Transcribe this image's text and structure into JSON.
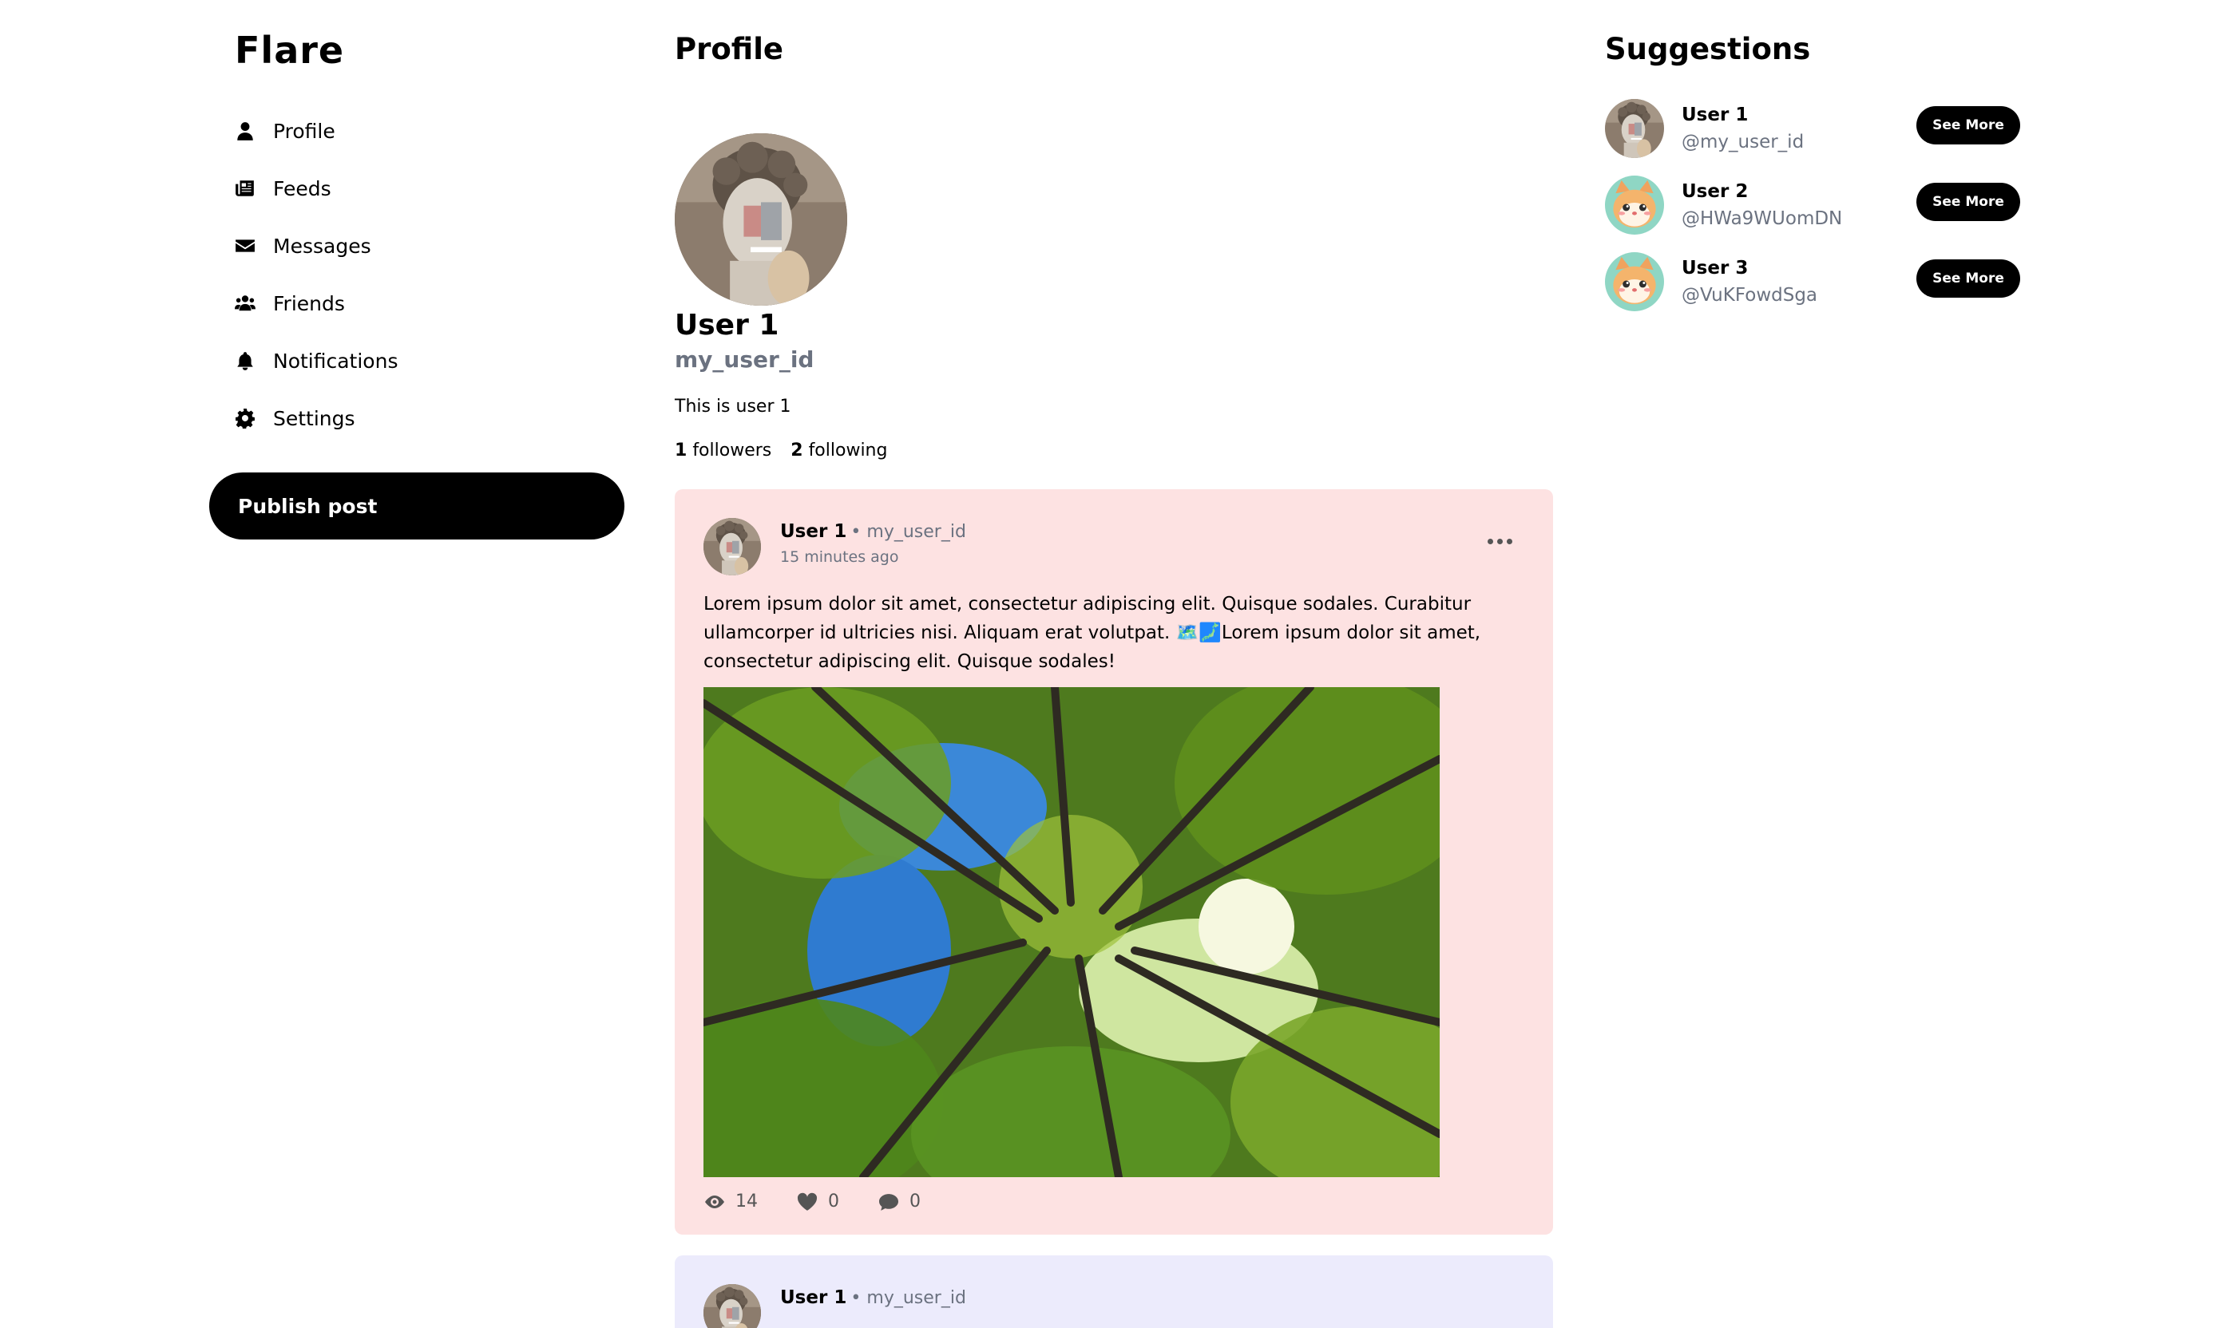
{
  "brand": "Flare",
  "nav": [
    {
      "label": "Profile",
      "icon": "user-icon"
    },
    {
      "label": "Feeds",
      "icon": "newspaper-icon"
    },
    {
      "label": "Messages",
      "icon": "envelope-icon"
    },
    {
      "label": "Friends",
      "icon": "users-icon"
    },
    {
      "label": "Notifications",
      "icon": "bell-icon"
    },
    {
      "label": "Settings",
      "icon": "gear-icon"
    }
  ],
  "publish_label": "Publish post",
  "profile": {
    "page_title": "Profile",
    "name": "User 1",
    "handle": "my_user_id",
    "bio": "This is user 1",
    "followers_count": "1",
    "followers_label": "followers",
    "following_count": "2",
    "following_label": "following"
  },
  "posts": [
    {
      "author": "User 1",
      "handle": "• my_user_id",
      "time": "15 minutes ago",
      "text": "Lorem ipsum dolor sit amet, consectetur adipiscing elit. Quisque sodales. Curabitur ullamcorper id ultricies nisi. Aliquam erat volutpat. 🗺️🗾Lorem ipsum dolor sit amet, consectetur adipiscing elit. Quisque sodales!",
      "views": "14",
      "likes": "0",
      "comments": "0"
    },
    {
      "author": "User 1",
      "handle": "• my_user_id"
    }
  ],
  "suggestions": {
    "title": "Suggestions",
    "button_label": "See More",
    "items": [
      {
        "name": "User 1",
        "handle": "@my_user_id"
      },
      {
        "name": "User 2",
        "handle": "@HWa9WUomDN"
      },
      {
        "name": "User 3",
        "handle": "@VuKFowdSga"
      }
    ]
  }
}
